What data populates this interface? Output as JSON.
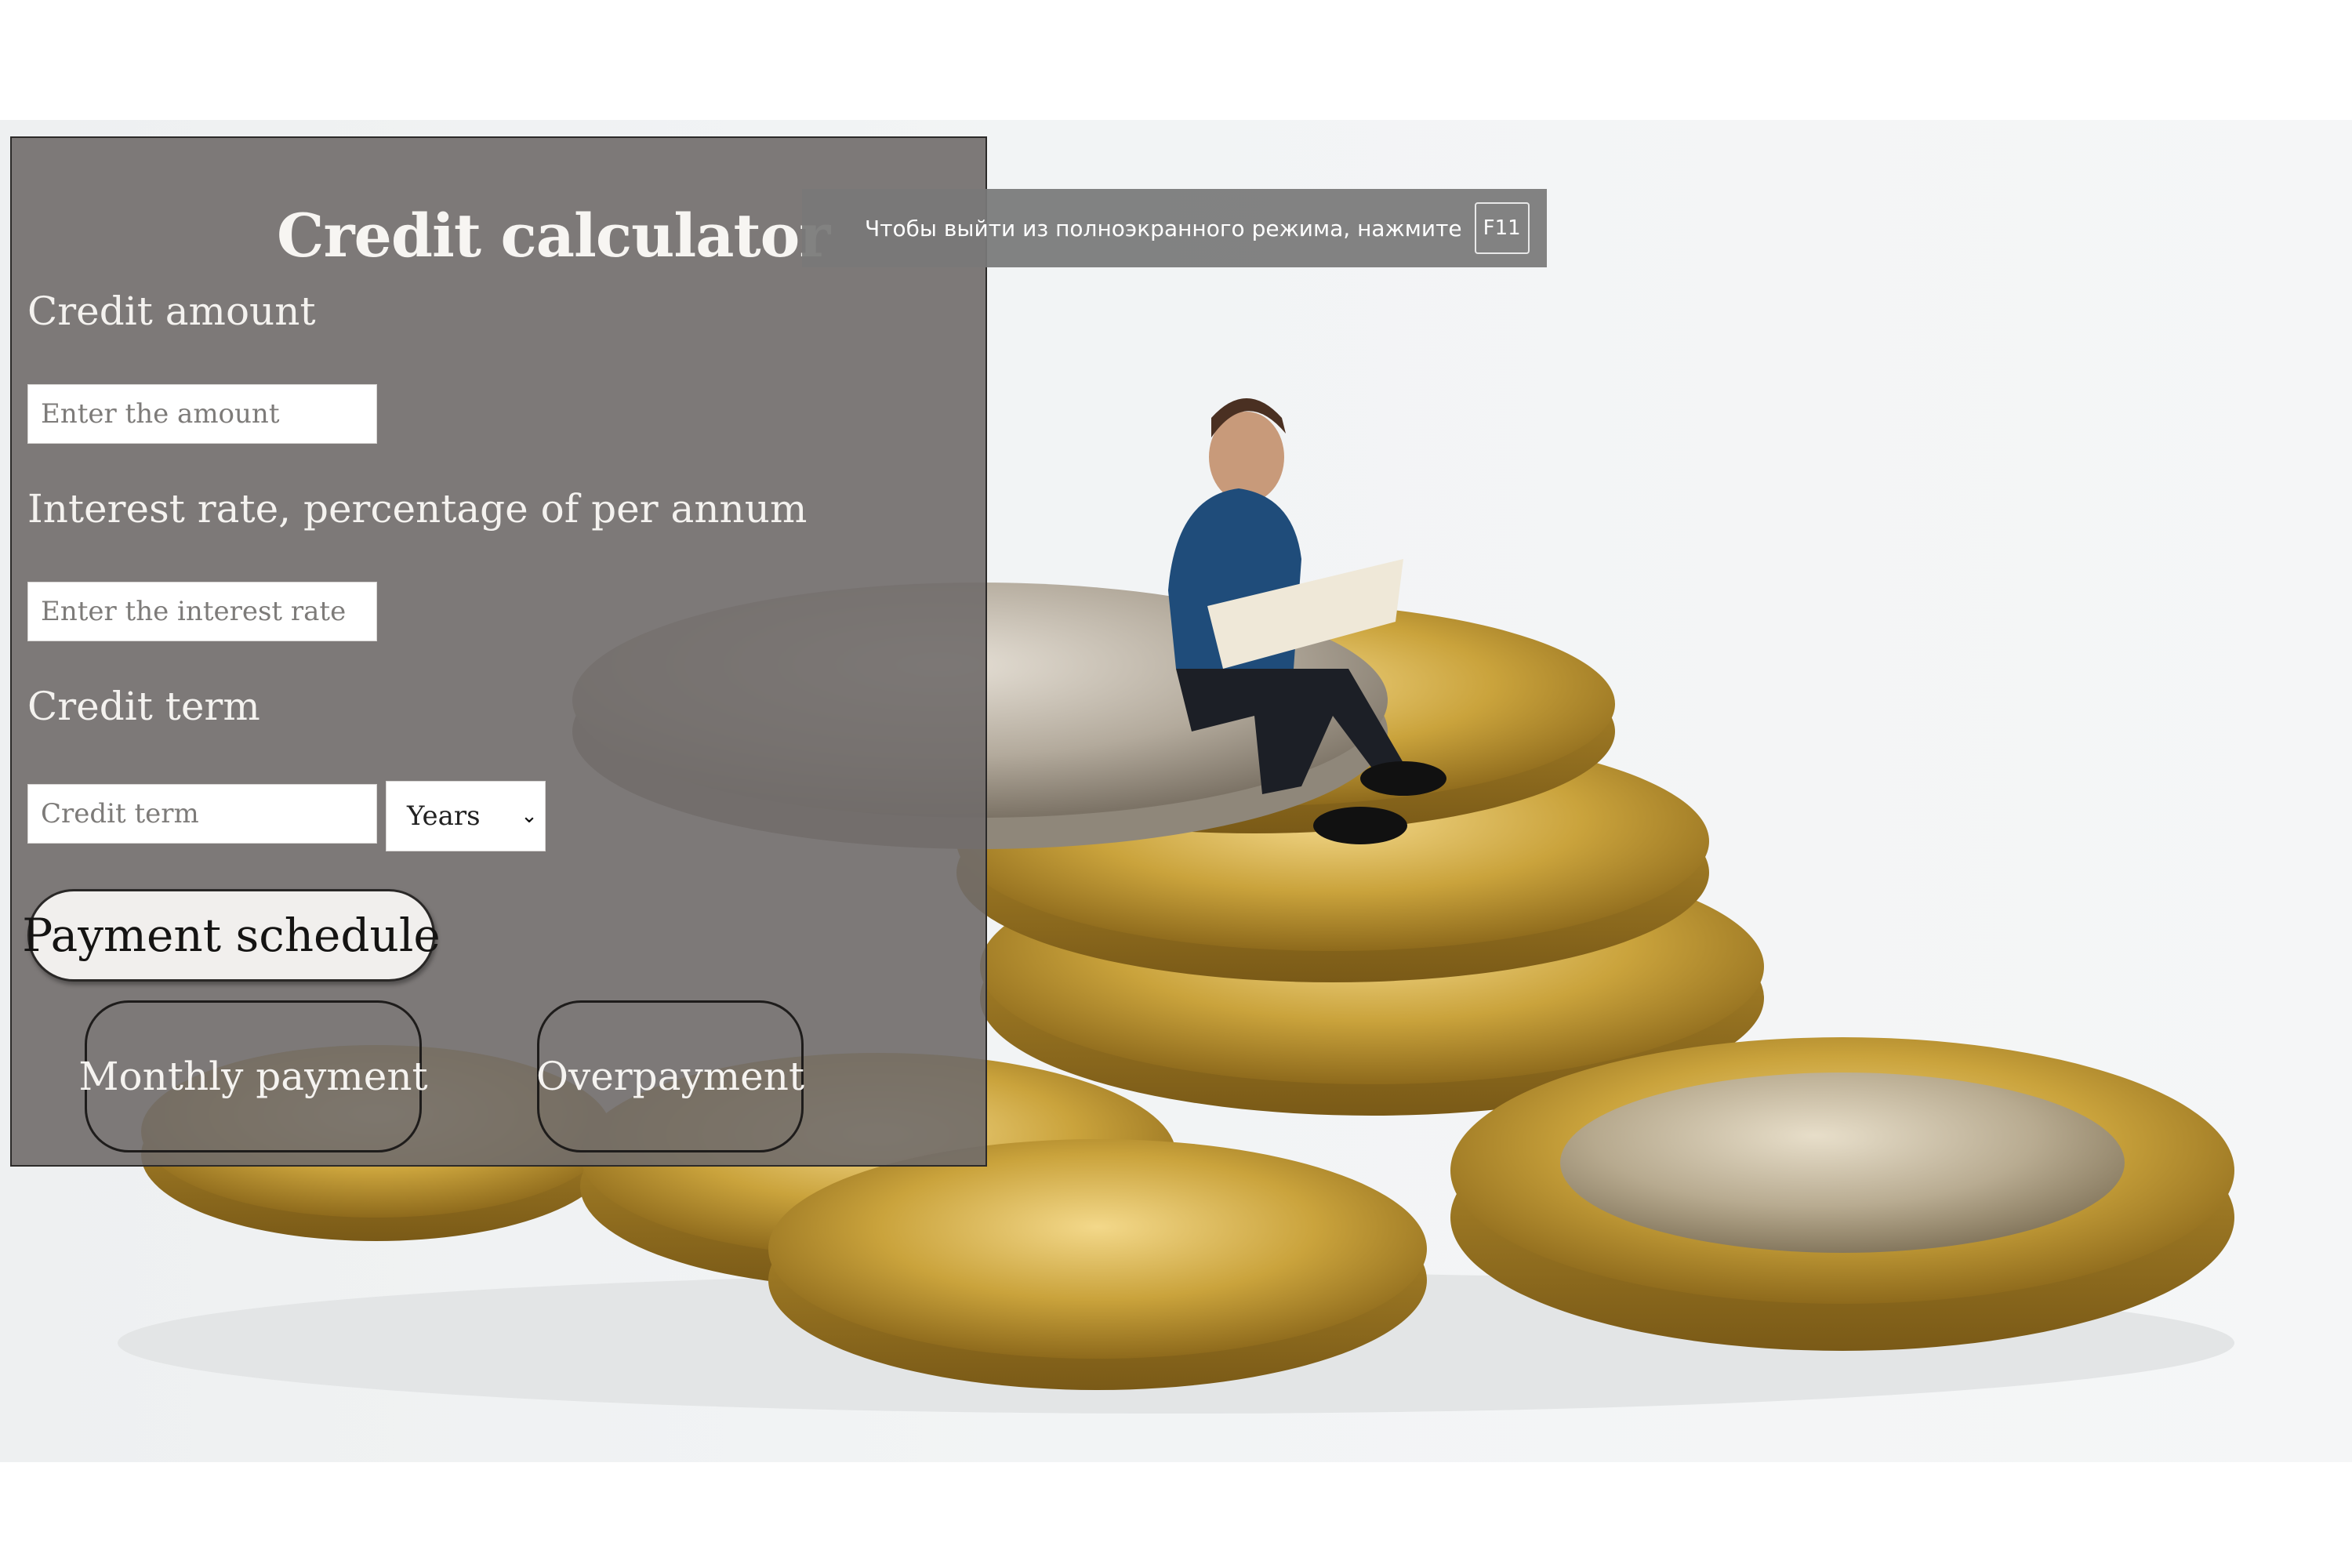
{
  "calculator": {
    "title": "Credit calculator",
    "amount_label": "Credit amount",
    "amount_placeholder": "Enter the amount",
    "rate_label": "Interest rate, percentage of per annum",
    "rate_placeholder": "Enter the interest rate",
    "term_label": "Credit term",
    "term_placeholder": "Credit term",
    "term_unit_selected": "Years",
    "schedule_button": "Payment schedule",
    "monthly_button": "Monthly payment",
    "overpayment_button": "Overpayment"
  },
  "fullscreen_notice": {
    "message": "Чтобы выйти из полноэкранного режима, нажмите",
    "key": "F11"
  },
  "background": {
    "subject": "figurine reading newspaper on stacked coins",
    "colors": {
      "coin_gold": "#c9a23a",
      "coin_silver": "#b9b2a6",
      "panel": "#706b6a"
    }
  },
  "icons": {
    "select_chevron": "chevron-down-icon"
  }
}
